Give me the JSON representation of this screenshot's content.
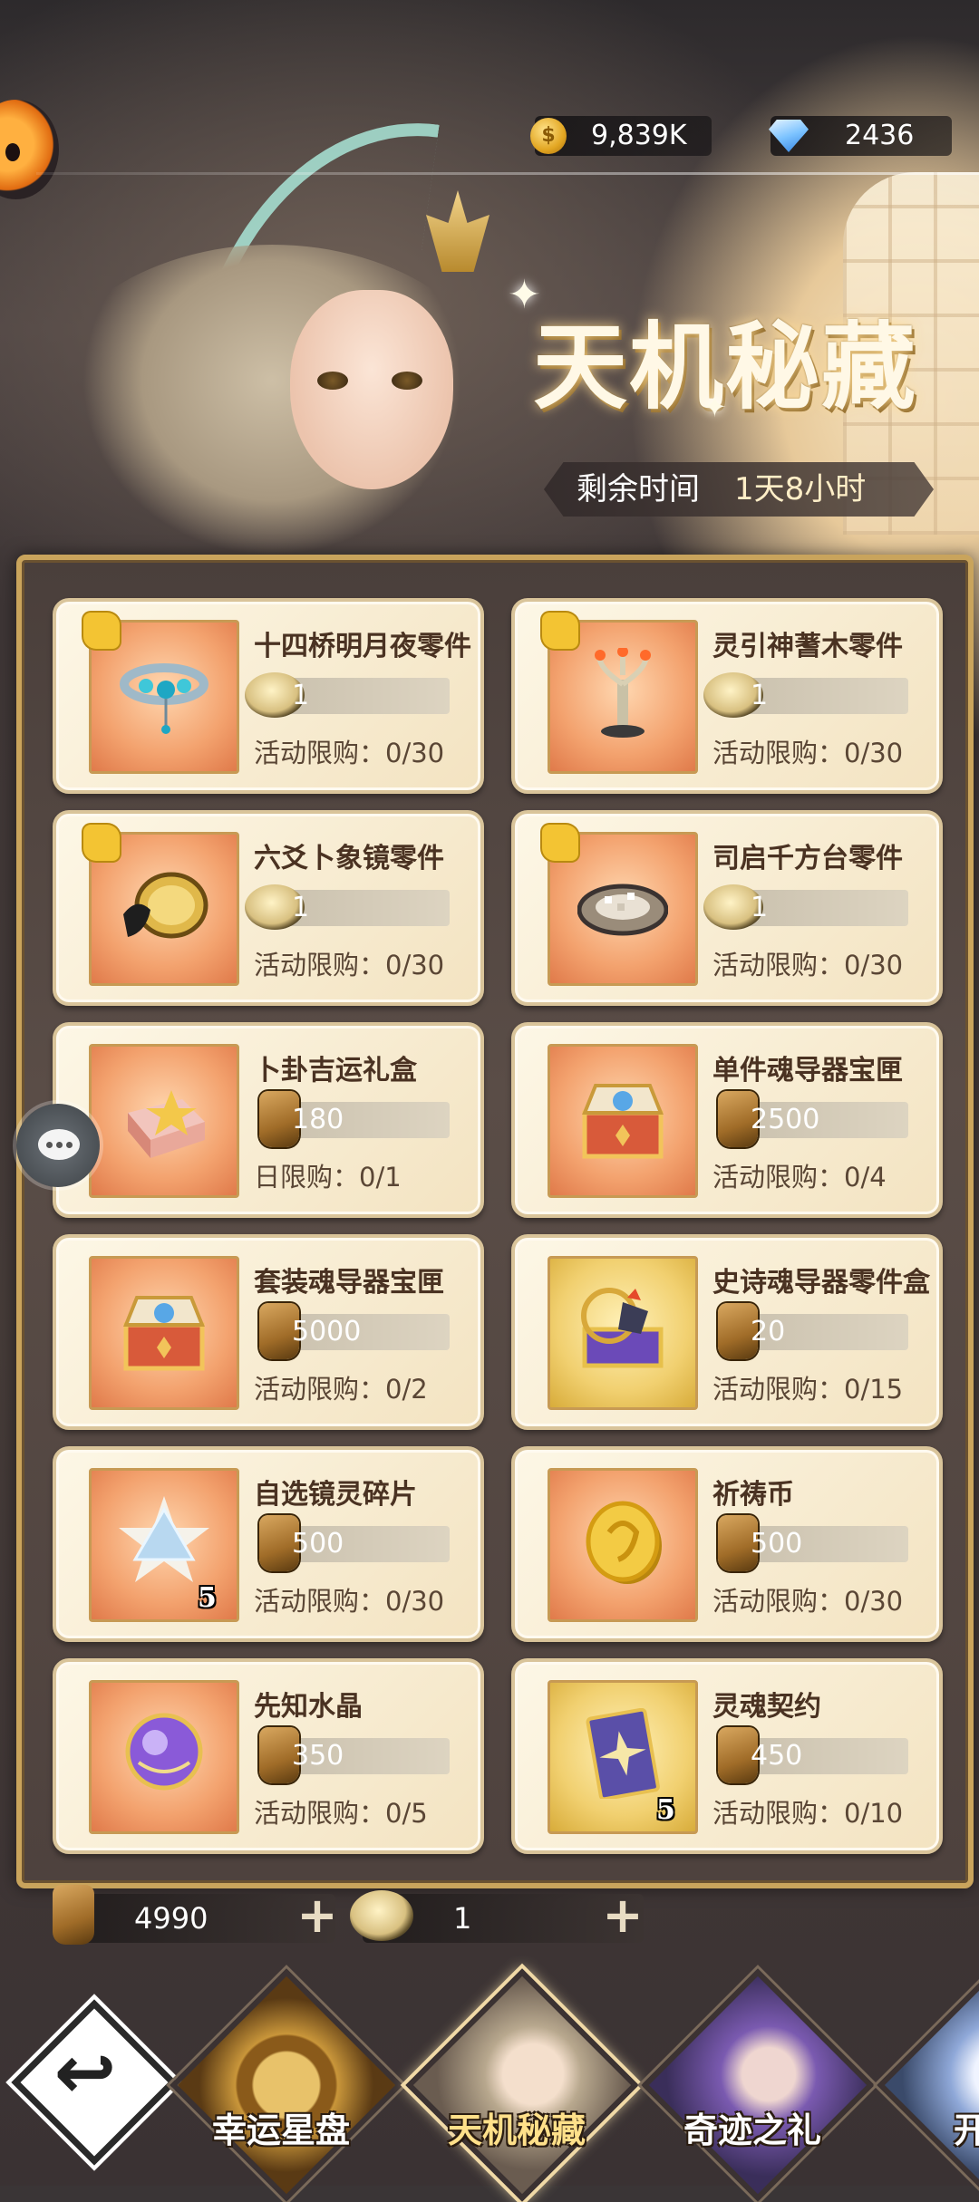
{
  "header": {
    "gold": "9,839K",
    "gems": "2436",
    "gold_icon": "gold-coin-icon",
    "gem_icon": "diamond-icon"
  },
  "event": {
    "title": "天机秘藏",
    "timer_label": "剩余时间",
    "timer_value": "1天8小时"
  },
  "shop": {
    "items": [
      {
        "name": "十四桥明月夜零件",
        "price": "1",
        "currency": "medal",
        "limit": "活动限购：0/30",
        "art": "bracelet",
        "piece": true,
        "bg": "orange"
      },
      {
        "name": "灵引神蓍木零件",
        "price": "1",
        "currency": "medal",
        "limit": "活动限购：0/30",
        "art": "tree",
        "piece": true,
        "bg": "orange"
      },
      {
        "name": "六爻卜象镜零件",
        "price": "1",
        "currency": "medal",
        "limit": "活动限购：0/30",
        "art": "mirror",
        "piece": true,
        "bg": "orange"
      },
      {
        "name": "司启千方台零件",
        "price": "1",
        "currency": "medal",
        "limit": "活动限购：0/30",
        "art": "platform",
        "piece": true,
        "bg": "orange"
      },
      {
        "name": "卜卦吉运礼盒",
        "price": "180",
        "currency": "token",
        "limit": "日限购：0/1",
        "art": "giftbox",
        "piece": false,
        "bg": "orange"
      },
      {
        "name": "单件魂导器宝匣",
        "price": "2500",
        "currency": "token",
        "limit": "活动限购：0/4",
        "art": "chest",
        "piece": false,
        "bg": "orange"
      },
      {
        "name": "套装魂导器宝匣",
        "price": "5000",
        "currency": "token",
        "limit": "活动限购：0/2",
        "art": "chest",
        "piece": false,
        "bg": "orange"
      },
      {
        "name": "史诗魂导器零件盒",
        "price": "20",
        "currency": "token",
        "limit": "活动限购：0/15",
        "art": "epicbox",
        "piece": false,
        "bg": "gold"
      },
      {
        "name": "自选镜灵碎片",
        "price": "500",
        "currency": "token",
        "limit": "活动限购：0/30",
        "art": "crystal",
        "piece": false,
        "bg": "orange",
        "qty": "5"
      },
      {
        "name": "祈祷币",
        "price": "500",
        "currency": "token",
        "limit": "活动限购：0/30",
        "art": "coin",
        "piece": false,
        "bg": "orange"
      },
      {
        "name": "先知水晶",
        "price": "350",
        "currency": "token",
        "limit": "活动限购：0/5",
        "art": "orb",
        "piece": false,
        "bg": "orange"
      },
      {
        "name": "灵魂契约",
        "price": "450",
        "currency": "token",
        "limit": "活动限购：0/10",
        "art": "card",
        "piece": false,
        "bg": "gold",
        "qty": "5"
      }
    ]
  },
  "wallet": {
    "token_amount": "4990",
    "medal_amount": "1",
    "plus": "+"
  },
  "nav": {
    "back_icon": "back-arrow-icon",
    "back_glyph": "↩",
    "tabs": [
      {
        "label": "幸运星盘",
        "active": false
      },
      {
        "label": "天机秘藏",
        "active": true
      },
      {
        "label": "奇迹之礼",
        "active": false
      },
      {
        "label": "开服",
        "active": false
      }
    ]
  },
  "colors": {
    "card_bg": "#f3e3c1",
    "frame_gold": "#c9a45c",
    "active_tab": "#ffe08a"
  }
}
